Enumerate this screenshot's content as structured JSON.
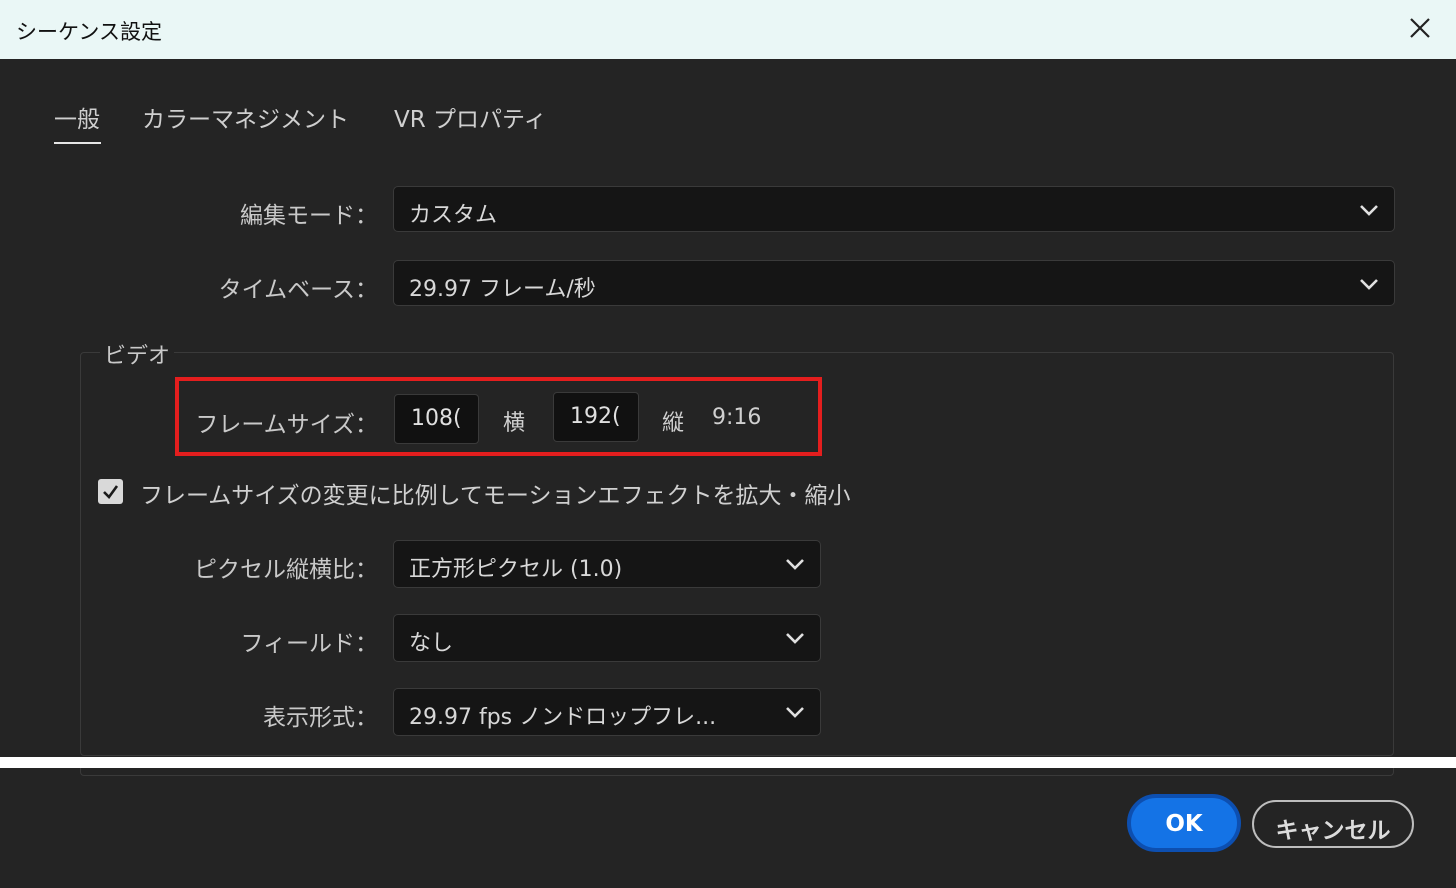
{
  "window": {
    "title": "シーケンス設定"
  },
  "tabs": [
    {
      "label": "一般"
    },
    {
      "label": "カラーマネジメント"
    },
    {
      "label": "VR プロパティ"
    }
  ],
  "edit_mode": {
    "label": "編集モード：",
    "value": "カスタム"
  },
  "timebase": {
    "label": "タイムベース：",
    "value": "29.97  フレーム/秒"
  },
  "video": {
    "group_label": "ビデオ",
    "frame_size": {
      "label": "フレームサイズ：",
      "width": "108(",
      "width_unit": "横",
      "height": "192(",
      "height_unit": "縦",
      "aspect": "9:16"
    },
    "scale_checkbox": {
      "checked": true,
      "label": "フレームサイズの変更に比例してモーションエフェクトを拡大・縮小"
    },
    "pixel_aspect": {
      "label": "ピクセル縦横比：",
      "value": "正方形ピクセル (1.0)"
    },
    "fields": {
      "label": "フィールド：",
      "value": "なし"
    },
    "display_format": {
      "label": "表示形式：",
      "value": "29.97 fps ノンドロップフレ..."
    }
  },
  "buttons": {
    "ok": "OK",
    "cancel": "キャンセル"
  },
  "colors": {
    "accent": "#1473e6",
    "highlight": "#e41e1e",
    "background": "#242424",
    "titlebar": "#eaf7f6"
  }
}
